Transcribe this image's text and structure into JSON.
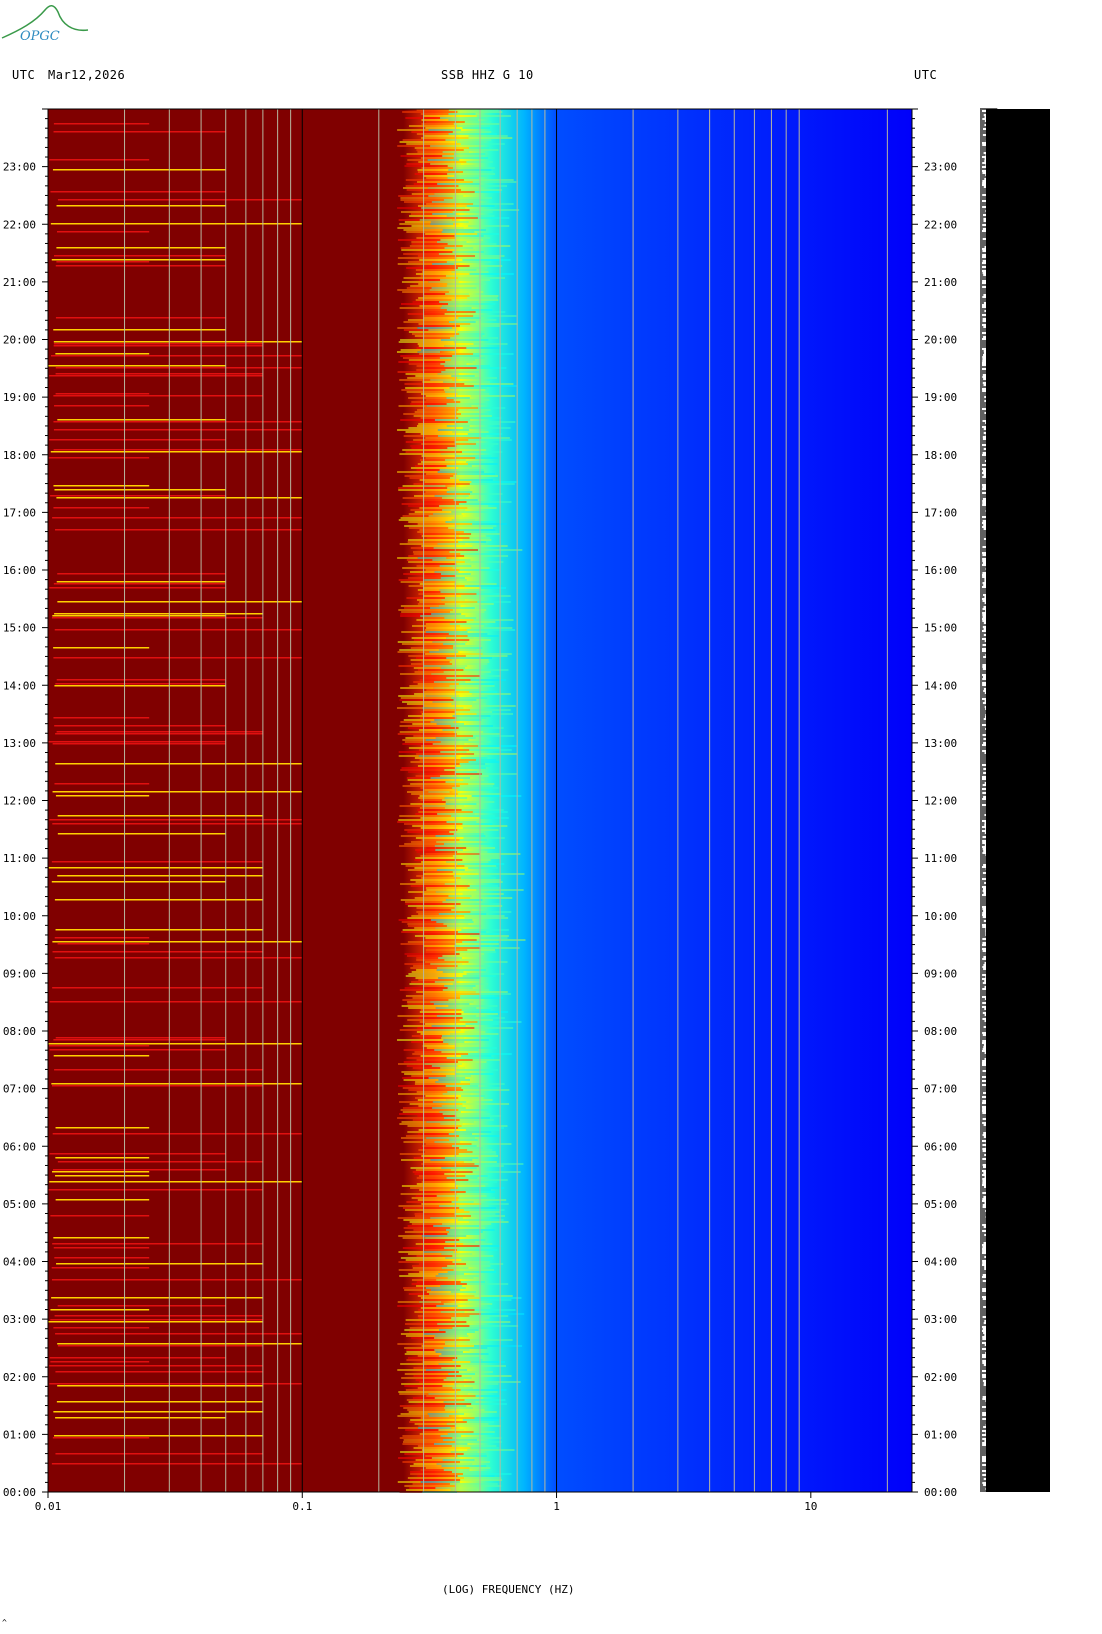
{
  "header": {
    "left_tz": "UTC",
    "date": "Mar12,2026",
    "title": "SSB HHZ G 10",
    "right_tz": "UTC"
  },
  "logo": {
    "text": "OPGC",
    "color": "#2e8bc0",
    "swoosh_color": "#3a9a4a"
  },
  "corner_mark": "^",
  "chart_data": {
    "type": "heatmap",
    "title": "SSB HHZ G 10",
    "xlabel": "(LOG) FREQUENCY (HZ)",
    "ylabel": "",
    "x_scale": "log",
    "xlim": [
      0.01,
      25
    ],
    "x_ticks": [
      0.01,
      0.1,
      1,
      10
    ],
    "x_tick_labels": [
      "0.01",
      "0.1",
      "1",
      "10"
    ],
    "ylim": [
      "00:00",
      "24:00"
    ],
    "y_tick_labels": [
      "00:00",
      "01:00",
      "02:00",
      "03:00",
      "04:00",
      "05:00",
      "06:00",
      "07:00",
      "08:00",
      "09:00",
      "10:00",
      "11:00",
      "12:00",
      "13:00",
      "14:00",
      "15:00",
      "16:00",
      "17:00",
      "18:00",
      "19:00",
      "20:00",
      "21:00",
      "22:00",
      "23:00"
    ],
    "y_tick_labels_right": [
      "00:00",
      "01:00",
      "02:00",
      "03:00",
      "04:00",
      "05:00",
      "06:00",
      "07:00",
      "08:00",
      "09:00",
      "10:00",
      "11:00",
      "12:00",
      "13:00",
      "14:00",
      "15:00",
      "16:00",
      "17:00",
      "18:00",
      "19:00",
      "20:00",
      "21:00",
      "22:00",
      "23:00"
    ],
    "colormap": "jet",
    "spectral_profile": [
      {
        "freq": 0.01,
        "level": 1.0
      },
      {
        "freq": 0.25,
        "level": 1.0
      },
      {
        "freq": 0.33,
        "level": 0.82
      },
      {
        "freq": 0.42,
        "level": 0.62
      },
      {
        "freq": 0.55,
        "level": 0.42
      },
      {
        "freq": 0.75,
        "level": 0.3
      },
      {
        "freq": 1.0,
        "level": 0.2
      },
      {
        "freq": 25,
        "level": 0.12
      }
    ],
    "gridlines_hz": [
      0.02,
      0.03,
      0.04,
      0.05,
      0.06,
      0.07,
      0.08,
      0.09,
      0.2,
      0.3,
      0.4,
      0.5,
      0.6,
      0.7,
      0.8,
      0.9,
      2,
      3,
      4,
      5,
      6,
      7,
      8,
      9,
      20
    ],
    "major_gridlines_hz": [
      0.1,
      1
    ],
    "colors": {
      "saturated": "#800000",
      "low": "#00008f",
      "grid_minor": "#b8b8a0",
      "grid_major": "#000000"
    },
    "side_panel": {
      "type": "seismogram_trace",
      "color": "#000000"
    }
  }
}
